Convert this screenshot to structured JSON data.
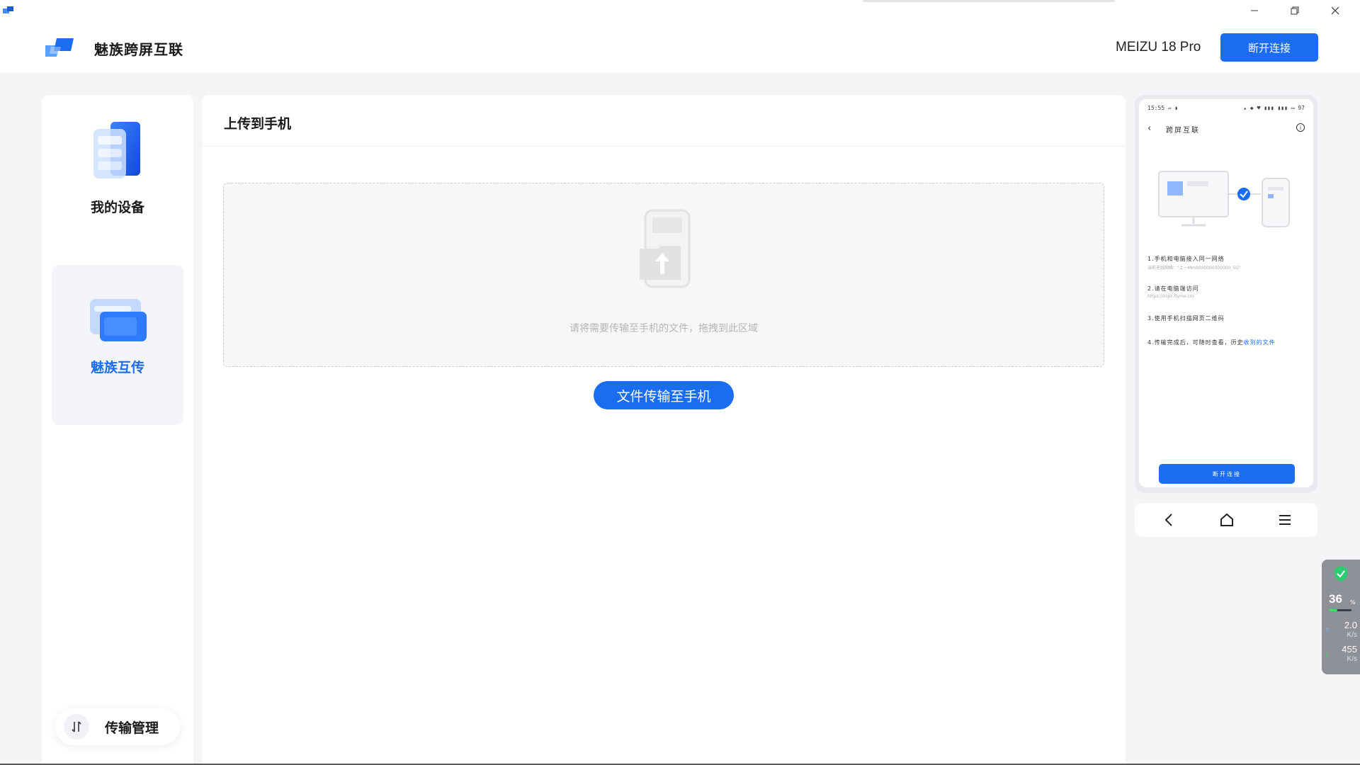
{
  "app": {
    "title": "魅族跨屏互联",
    "device_name": "MEIZU 18 Pro",
    "disconnect_label": "断开连接"
  },
  "window_controls": {
    "minimize": "—",
    "maximize": "❐",
    "close": "✕"
  },
  "sidebar": {
    "items": [
      {
        "label": "我的设备",
        "icon": "devices-icon",
        "active": false
      },
      {
        "label": "魅族互传",
        "icon": "folder-transfer-icon",
        "active": true
      }
    ],
    "transfer_manager_label": "传输管理"
  },
  "main": {
    "title": "上传到手机",
    "dropzone_hint": "请将需要传输至手机的文件，拖拽到此区域",
    "send_button_label": "文件传输至手机"
  },
  "phone": {
    "status_left": "15:55 ▱ ◗",
    "status_right": "▴ ◆ ♥ ▮▮▮ ▮▮▮ ▭ 97",
    "header_title": "跨屏互联",
    "steps": [
      {
        "text": "1.手机和电脑接入同一网络",
        "sub": "当前无线网络：\"上一Mm0000000000000_5G\""
      },
      {
        "text": "2.请在电脑端访问",
        "sub": "https://inlpc.flyme.cn/"
      },
      {
        "text": "3.使用手机扫描网页二维码",
        "sub": ""
      },
      {
        "text": "4.传输完成后，可随时查看，历史",
        "link": "收到的文件"
      }
    ],
    "bottom_button_label": "断开连接"
  },
  "net_widget": {
    "percent": "36",
    "percent_unit": "%",
    "percent_value": 0.36,
    "upload": "2.0",
    "upload_unit": "K/s",
    "download": "455",
    "download_unit": "K/s"
  },
  "colors": {
    "accent": "#1a6cf0",
    "background": "#f4f5f7"
  }
}
